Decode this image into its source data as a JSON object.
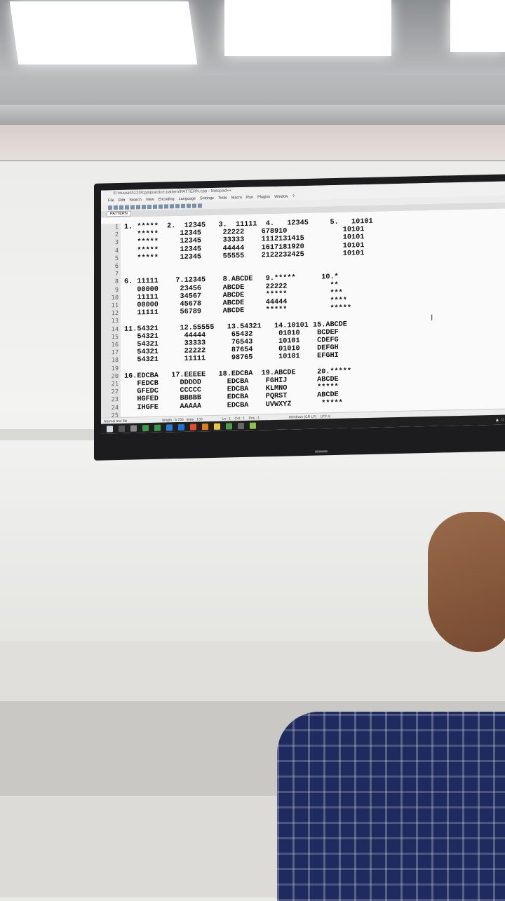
{
  "editor": {
    "title": "E:\\manash123\\cpp\\practice pattern\\PATTERN.cpp - Notepad++",
    "menu": [
      "File",
      "Edit",
      "Search",
      "View",
      "Encoding",
      "Language",
      "Settings",
      "Tools",
      "Macro",
      "Run",
      "Plugins",
      "Window",
      "?"
    ],
    "tab": "PATTERN",
    "line_numbers": [
      "1",
      "2",
      "3",
      "4",
      "5",
      "6",
      "7",
      "8",
      "9",
      "10",
      "11",
      "12",
      "13",
      "14",
      "15",
      "16",
      "17",
      "18",
      "19",
      "20",
      "21",
      "22",
      "23",
      "24",
      "25"
    ],
    "lines": [
      "1. *****  2.  12345   3.  11111  4.   12345     5.   10101",
      "   *****     12345     22222    678910             10101",
      "   *****     12345     33333    1112131415         10101",
      "   *****     12345     44444    1617181920         10101",
      "   *****     12345     55555    2122232425         10101",
      "",
      "",
      "6. 11111    7.12345    8.ABCDE   9.*****      10.*",
      "   00000     23456     ABCDE     22222          **",
      "   11111     34567     ABCDE     *****          ***",
      "   00000     45678     ABCDE     44444          ****",
      "   11111     56789     ABCDE     *****          *****",
      "",
      "11.54321     12.55555   13.54321   14.10101 15.ABCDE",
      "   54321      44444      65432      01010    BCDEF",
      "   54321      33333      76543      10101    CDEFG",
      "   54321      22222      87654      01010    DEFGH",
      "   54321      11111      98765      10101    EFGHI",
      "",
      "16.EDCBA   17.EEEEE   18.EDCBA  19.ABCDE     20.*****",
      "   FEDCB     DDDDD      EDCBA    FGHIJ       ABCDE",
      "   GFEDC     CCCCC      EDCBA    KLMNO       *****",
      "   HGFED     BBBBB      EDCBA    PQRST       ABCDE",
      "   IHGFE     AAAAA      EDCBA    UVWXYZ       *****",
      ""
    ],
    "status": "Normal text file                                    length : 5,755   lines : 130                    Ln : 1    Col : 1    Pos : 1                              Windows (CR LF)    UTF-8"
  }
}
